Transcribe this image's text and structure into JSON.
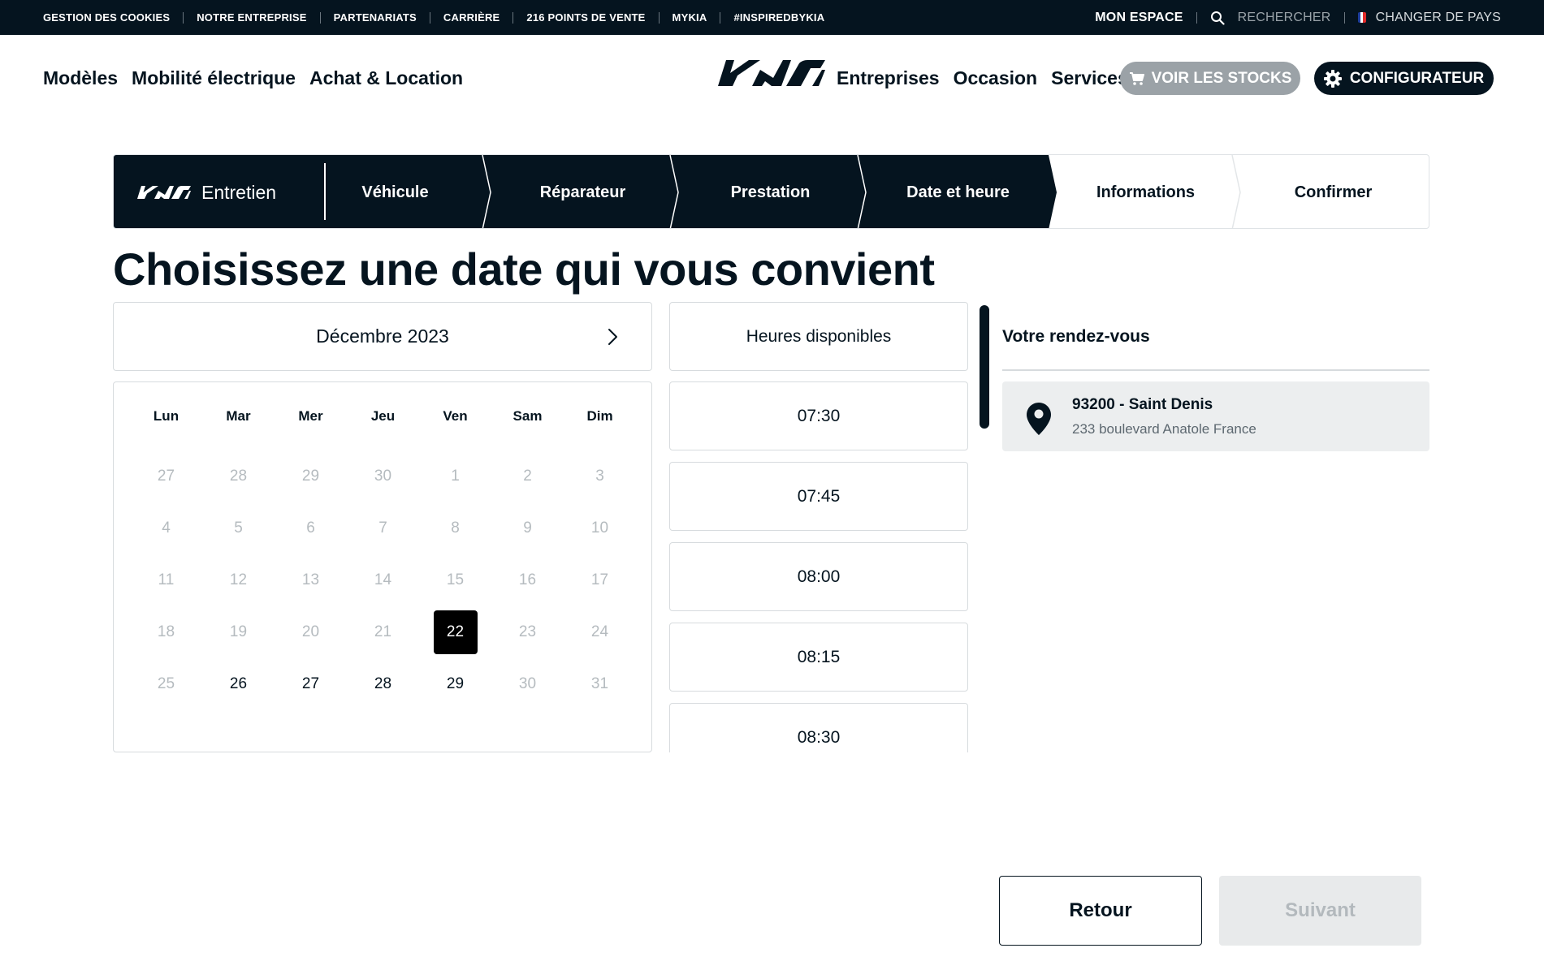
{
  "topbar": {
    "links": [
      "GESTION DES COOKIES",
      "NOTRE ENTREPRISE",
      "PARTENARIATS",
      "CARRIÈRE",
      "216 POINTS DE VENTE",
      "MYKIA",
      "#INSPIREDBYKIA"
    ],
    "account": "MON ESPACE",
    "search": "RECHERCHER",
    "country": "CHANGER DE PAYS"
  },
  "nav": {
    "left": [
      "Modèles",
      "Mobilité électrique",
      "Achat & Location"
    ],
    "right": [
      "Entreprises",
      "Occasion",
      "Services"
    ],
    "stock_button": "VOIR LES STOCKS",
    "config_button": "CONFIGURATEUR"
  },
  "stepper": {
    "brand_label": "Entretien",
    "steps": [
      {
        "label": "Véhicule",
        "state": "done"
      },
      {
        "label": "Réparateur",
        "state": "done"
      },
      {
        "label": "Prestation",
        "state": "done"
      },
      {
        "label": "Date et heure",
        "state": "current"
      },
      {
        "label": "Informations",
        "state": "todo"
      },
      {
        "label": "Confirmer",
        "state": "todo"
      }
    ]
  },
  "title": "Choisissez une date qui vous convient",
  "calendar": {
    "month": "Décembre 2023",
    "weekdays": [
      "Lun",
      "Mar",
      "Mer",
      "Jeu",
      "Ven",
      "Sam",
      "Dim"
    ],
    "weeks": [
      [
        {
          "d": "27",
          "s": "disabled"
        },
        {
          "d": "28",
          "s": "disabled"
        },
        {
          "d": "29",
          "s": "disabled"
        },
        {
          "d": "30",
          "s": "disabled"
        },
        {
          "d": "1",
          "s": "disabled"
        },
        {
          "d": "2",
          "s": "disabled"
        },
        {
          "d": "3",
          "s": "disabled"
        }
      ],
      [
        {
          "d": "4",
          "s": "disabled"
        },
        {
          "d": "5",
          "s": "disabled"
        },
        {
          "d": "6",
          "s": "disabled"
        },
        {
          "d": "7",
          "s": "disabled"
        },
        {
          "d": "8",
          "s": "disabled"
        },
        {
          "d": "9",
          "s": "disabled"
        },
        {
          "d": "10",
          "s": "disabled"
        }
      ],
      [
        {
          "d": "11",
          "s": "disabled"
        },
        {
          "d": "12",
          "s": "disabled"
        },
        {
          "d": "13",
          "s": "disabled"
        },
        {
          "d": "14",
          "s": "disabled"
        },
        {
          "d": "15",
          "s": "disabled"
        },
        {
          "d": "16",
          "s": "disabled"
        },
        {
          "d": "17",
          "s": "disabled"
        }
      ],
      [
        {
          "d": "18",
          "s": "disabled"
        },
        {
          "d": "19",
          "s": "disabled"
        },
        {
          "d": "20",
          "s": "disabled"
        },
        {
          "d": "21",
          "s": "disabled"
        },
        {
          "d": "22",
          "s": "selected"
        },
        {
          "d": "23",
          "s": "disabled"
        },
        {
          "d": "24",
          "s": "disabled"
        }
      ],
      [
        {
          "d": "25",
          "s": "disabled"
        },
        {
          "d": "26",
          "s": "available"
        },
        {
          "d": "27",
          "s": "available"
        },
        {
          "d": "28",
          "s": "available"
        },
        {
          "d": "29",
          "s": "available"
        },
        {
          "d": "30",
          "s": "disabled"
        },
        {
          "d": "31",
          "s": "disabled"
        }
      ]
    ]
  },
  "slots": {
    "header": "Heures disponibles",
    "times": [
      "07:30",
      "07:45",
      "08:00",
      "08:15",
      "08:30"
    ]
  },
  "appointment": {
    "title": "Votre rendez-vous",
    "name": "93200 - Saint Denis",
    "address": "233 boulevard Anatole France"
  },
  "actions": {
    "back": "Retour",
    "next": "Suivant"
  },
  "colors": {
    "navy": "#05141f",
    "grey_button": "#9ba2a7",
    "disabled_text": "#b5bbbf"
  }
}
